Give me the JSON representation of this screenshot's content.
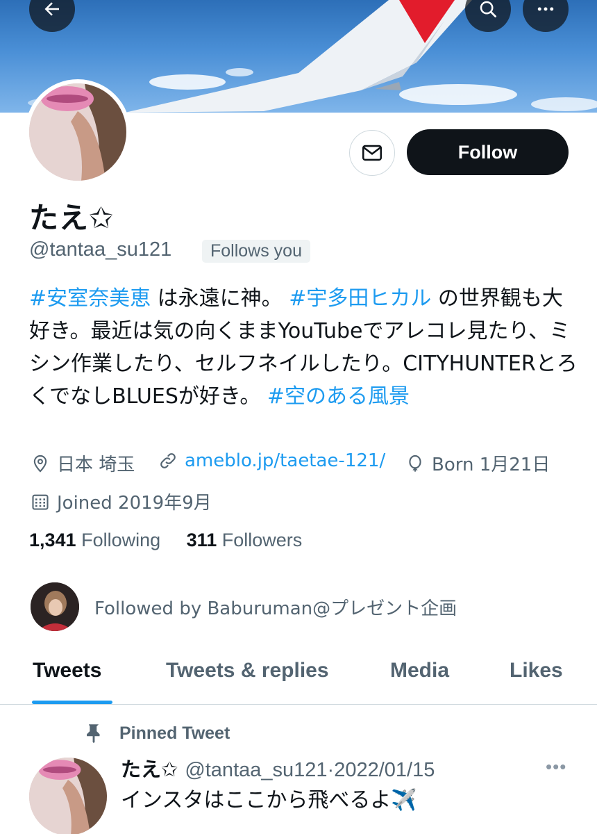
{
  "header": {
    "back_icon": "arrow-left-icon",
    "search_icon": "search-icon",
    "more_icon": "more-horizontal-icon"
  },
  "profile": {
    "display_name": "たえ✩",
    "handle": "@tantaa_su121",
    "follows_you": "Follows you",
    "follow_label": "Follow",
    "message_icon": "mail-icon"
  },
  "bio": {
    "tag1": "#安室奈美恵",
    "text1": " は永遠に神。 ",
    "tag2": "#宇多田ヒカル",
    "text2": " の世界観も大好き。最近は気の向くままYouTubeでアレコレ見たり、ミシン作業したり、セルフネイルしたり。CITYHUNTERとろくでなしBLUESが好き。 ",
    "tag3": "#空のある風景"
  },
  "meta": {
    "location": "日本 埼玉",
    "url": "ameblo.jp/taetae-121/",
    "born": "Born 1月21日",
    "joined": "Joined 2019年9月"
  },
  "stats": {
    "following_count": "1,341",
    "following_label": " Following",
    "followers_count": "311",
    "followers_label": " Followers"
  },
  "followed_by": "Followed by Baburuman@プレゼント企画",
  "tabs": [
    {
      "label": "Tweets",
      "active": true
    },
    {
      "label": "Tweets & replies",
      "active": false
    },
    {
      "label": "Media",
      "active": false
    },
    {
      "label": "Likes",
      "active": false
    }
  ],
  "pinned_tweet": {
    "pinned_label": "Pinned Tweet",
    "author": "たえ✩",
    "handle": "@tantaa_su121",
    "separator": "·",
    "date": "2022/01/15",
    "text": "インスタはここから飛べるよ✈️",
    "more": "•••"
  },
  "colors": {
    "accent": "#1d9bf0",
    "text_primary": "#0f1419",
    "text_secondary": "#536471",
    "follow_button_bg": "#0f1419"
  }
}
